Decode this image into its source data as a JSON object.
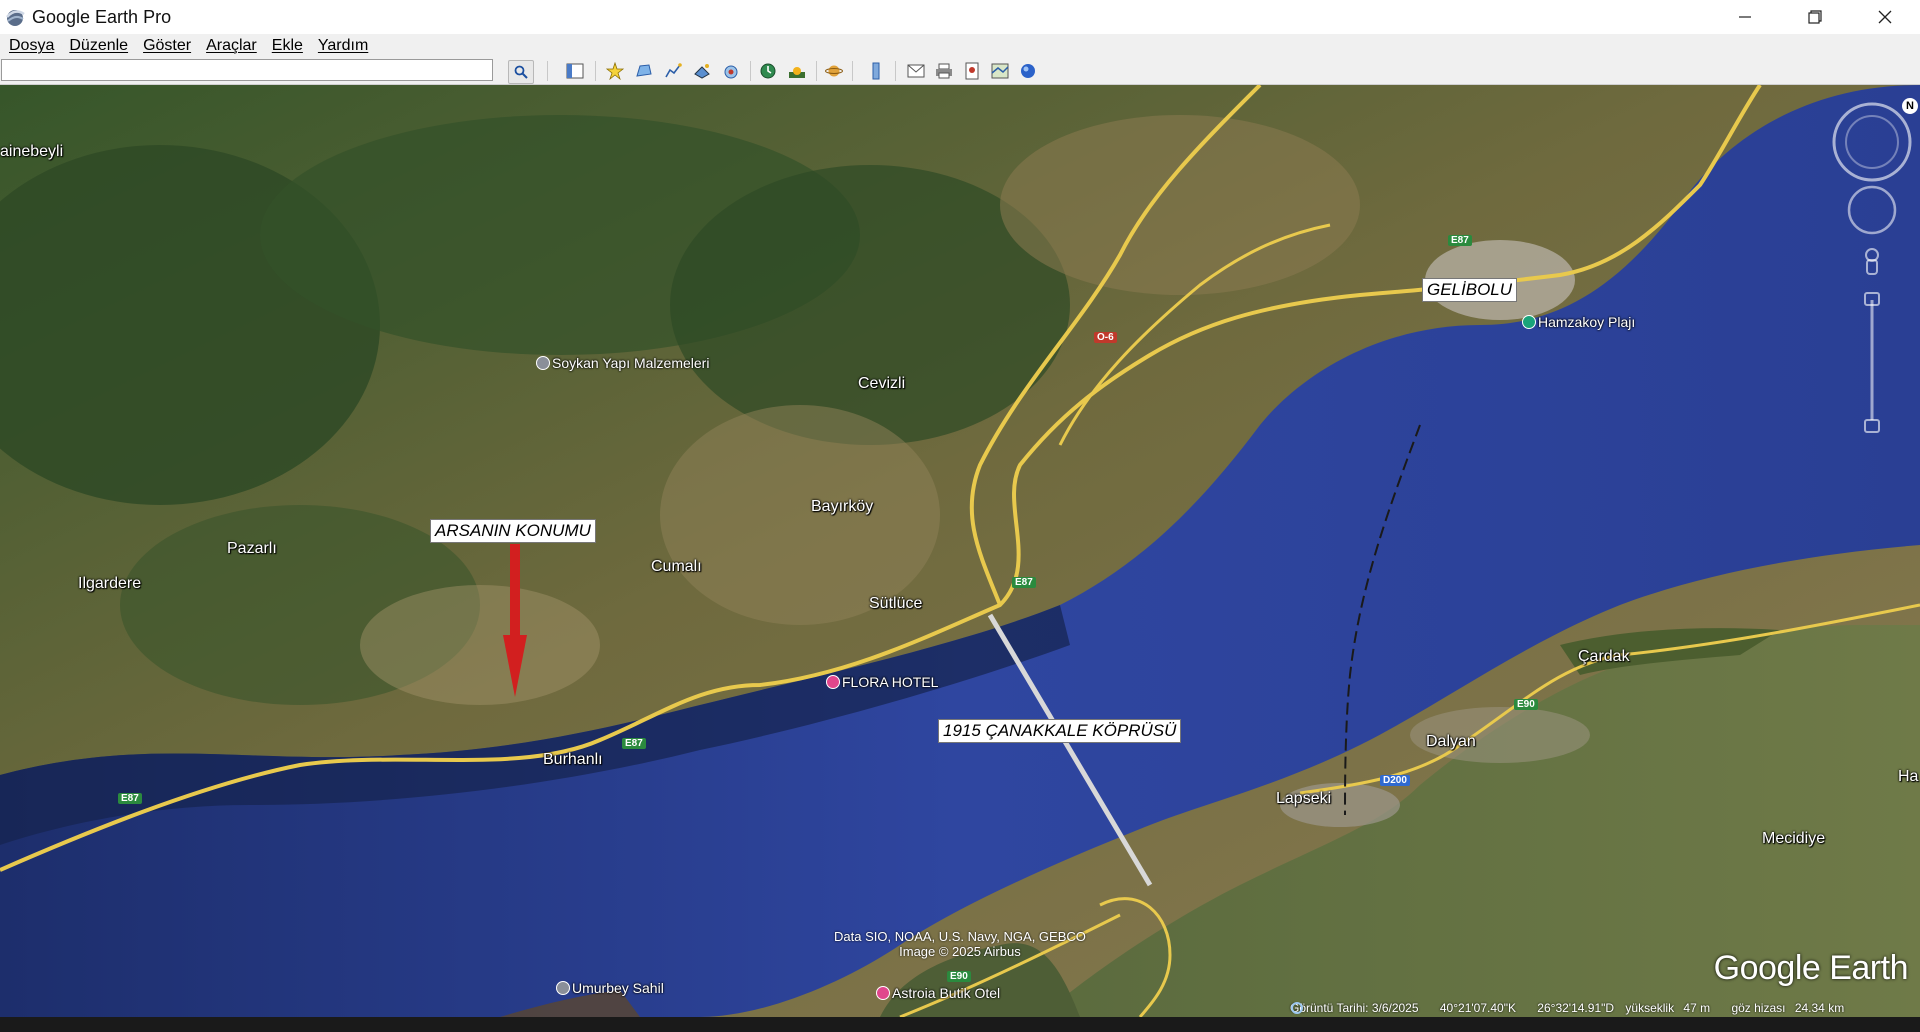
{
  "window": {
    "title": "Google Earth Pro",
    "minimize_icon": "minimize-icon",
    "restore_icon": "restore-icon",
    "close_icon": "close-icon"
  },
  "menu": [
    "Dosya",
    "Düzenle",
    "Göster",
    "Araçlar",
    "Ekle",
    "Yardım"
  ],
  "search": {
    "value": "",
    "button_icon": "search-icon"
  },
  "toolbar_icons": [
    "sidebar-icon",
    "placemark-icon",
    "polygon-icon",
    "path-icon",
    "image-overlay-icon",
    "record-tour-icon",
    "historical-imagery-icon",
    "sunlight-icon",
    "planets-icon",
    "ruler-icon",
    "email-icon",
    "print-icon",
    "save-image-icon",
    "view-in-maps-icon",
    "sky-icon"
  ],
  "map": {
    "annotations": {
      "plot": "ARSANIN KONUMU",
      "bridge": "1915 ÇANAKKALE KÖPRÜSÜ",
      "city": "GELİBOLU"
    },
    "places": {
      "inebeyli": "ainebeyli",
      "pazarli": "Pazarlı",
      "ilgardere": "Ilgardere",
      "cevizli": "Cevizli",
      "bayirkoy": "Bayırköy",
      "cumali": "Cumalı",
      "sutluce": "Sütlüce",
      "burhanli": "Burhanlı",
      "cardak": "Çardak",
      "dalyan": "Dalyan",
      "lapseki": "Lapseki",
      "mecidiye": "Mecidiye",
      "ha": "Ha"
    },
    "pois": {
      "soykan": "Soykan Yapı Malzemeleri",
      "flora": "FLORA HOTEL",
      "hamzakoy": "Hamzakoy Plajı",
      "umurbey": "Umurbey Sahil",
      "astroia": "Astroia Butik Otel"
    },
    "road_shields": {
      "e87_a": "E87",
      "e87_b": "E87",
      "e87_c": "E87",
      "e87_d": "E87",
      "o6": "O-6",
      "e90_a": "E90",
      "e90_b": "E90",
      "d200": "D200"
    },
    "attribution": [
      "Data SIO, NOAA, U.S. Navy, NGA, GEBCO",
      "Image © 2025 Airbus"
    ],
    "logo": "Google Earth",
    "status": {
      "imagery_date": "Görüntü Tarihi: 3/6/2025",
      "lat": "40°21'07.40\"K",
      "lon": "26°32'14.91\"D",
      "elevation_label": "yükseklik",
      "elevation": "47 m",
      "eye_label": "göz hizası",
      "eye_alt": "24.34 km"
    },
    "compass_letter": "N",
    "colors": {
      "sea": "#2b3f8f",
      "land": "#6b6a3c",
      "road": "#e6c64a",
      "bridge": "#d8d8d8",
      "arrow": "#d21f1f"
    }
  }
}
